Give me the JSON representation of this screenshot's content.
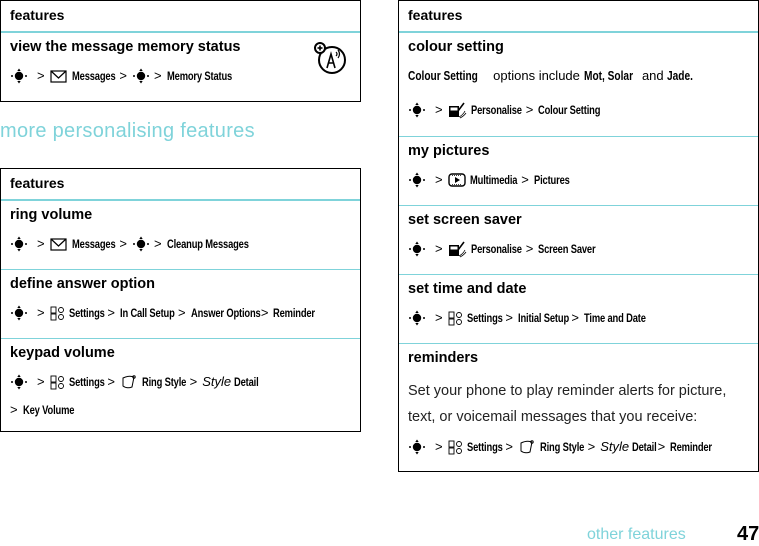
{
  "colors": {
    "accent": "#7fd3da",
    "border": "#000000"
  },
  "top_table": {
    "header": "features",
    "rows": [
      {
        "title": "view the message memory status",
        "badge_icon": "network-accessory-icon",
        "path": [
          {
            "icon": "nav-key-icon"
          },
          {
            "sep": ">"
          },
          {
            "icon": "envelope-icon",
            "label": "Messages"
          },
          {
            "sep": ">"
          },
          {
            "icon": "nav-key-icon"
          },
          {
            "sep": ">"
          },
          {
            "label": "Memory Status"
          }
        ]
      }
    ]
  },
  "section_heading": "more personalising features",
  "left_table": {
    "header": "features",
    "rows": [
      {
        "title": "ring volume",
        "path": [
          "Messages",
          "Cleanup Messages"
        ]
      },
      {
        "title": "define answer option",
        "path": [
          "Settings",
          "In Call Setup",
          "Answer Options",
          "Reminder"
        ]
      },
      {
        "title": "keypad volume",
        "path": [
          "Settings",
          "Ring Style",
          "Style",
          "Detail",
          "Key Volume"
        ]
      }
    ]
  },
  "right_table": {
    "header": "features",
    "rows": [
      {
        "title": "colour setting",
        "description": {
          "pre": "Colour Setting",
          "mid": " options include ",
          "opt1": "Mot, Solar",
          "and": " and ",
          "opt2": "Jade."
        },
        "path": [
          "Personalise",
          "Colour Setting"
        ]
      },
      {
        "title": "my pictures",
        "path": [
          "Multimedia",
          "Pictures"
        ]
      },
      {
        "title": "set screen saver",
        "path": [
          "Personalise",
          "Screen Saver"
        ]
      },
      {
        "title": "set time and date",
        "path": [
          "Settings",
          "Initial Setup",
          "Time and Date"
        ]
      },
      {
        "title": "reminders",
        "description_lines": [
          "Set your phone to play reminder alerts for picture,",
          "text, or voicemail messages that you receive:"
        ],
        "path": [
          "Settings",
          "Ring Style",
          "Style",
          "Detail",
          "Reminder"
        ]
      }
    ]
  },
  "separator": ">",
  "footer": {
    "label": "other features",
    "page_number": "47"
  }
}
